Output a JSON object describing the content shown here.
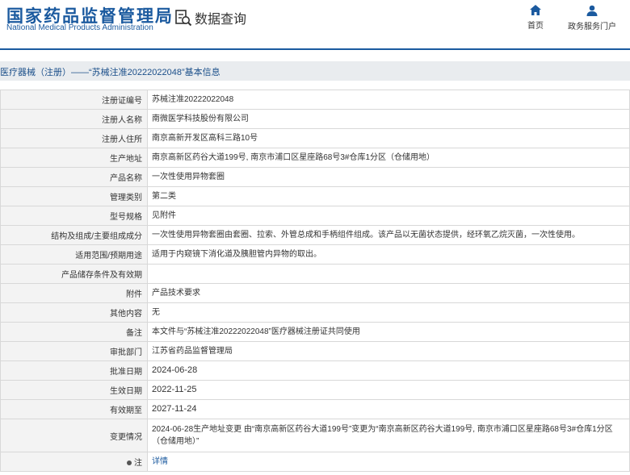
{
  "header": {
    "logo_cn": "国家药品监督管理局",
    "logo_en": "National Medical Products Administration",
    "query_label": "数据查询",
    "nav": [
      {
        "label": "首页",
        "icon": "home-icon"
      },
      {
        "label": "政务服务门户",
        "icon": "user-icon"
      }
    ],
    "brand_color": "#1b5a9f"
  },
  "breadcrumb": "医疗器械（注册）——“苏械注准20222022048”基本信息",
  "rows": [
    {
      "label": "注册证编号",
      "value": "苏械注准20222022048"
    },
    {
      "label": "注册人名称",
      "value": "南微医学科技股份有限公司"
    },
    {
      "label": "注册人住所",
      "value": "南京高新开发区高科三路10号"
    },
    {
      "label": "生产地址",
      "value": "南京高新区药谷大道199号, 南京市浦口区星座路68号3#仓库1分区（仓储用地）"
    },
    {
      "label": "产品名称",
      "value": "一次性使用异物套圈"
    },
    {
      "label": "管理类别",
      "value": "第二类"
    },
    {
      "label": "型号规格",
      "value": "见附件"
    },
    {
      "label": "结构及组成/主要组成成分",
      "value": "一次性使用异物套圈由套圈、拉索、外管总成和手柄组件组成。该产品以无菌状态提供，经环氧乙烷灭菌，一次性使用。"
    },
    {
      "label": "适用范围/预期用途",
      "value": "适用于内窥镜下消化道及胰胆管内异物的取出。"
    },
    {
      "label": "产品储存条件及有效期",
      "value": ""
    },
    {
      "label": "附件",
      "value": "产品技术要求"
    },
    {
      "label": "其他内容",
      "value": "无"
    },
    {
      "label": "备注",
      "value": "本文件与“苏械注准20222022048”医疗器械注册证共同使用"
    },
    {
      "label": "审批部门",
      "value": "江苏省药品监督管理局"
    },
    {
      "label": "批准日期",
      "value": "2024-06-28"
    },
    {
      "label": "生效日期",
      "value": "2022-11-25"
    },
    {
      "label": "有效期至",
      "value": "2027-11-24"
    },
    {
      "label": "变更情况",
      "value": "2024-06-28生产地址变更 由“南京高新区药谷大道199号”变更为“南京高新区药谷大道199号, 南京市浦口区星座路68号3#仓库1分区（仓储用地）”"
    }
  ],
  "note_row": {
    "label": "注",
    "value": "详情"
  }
}
